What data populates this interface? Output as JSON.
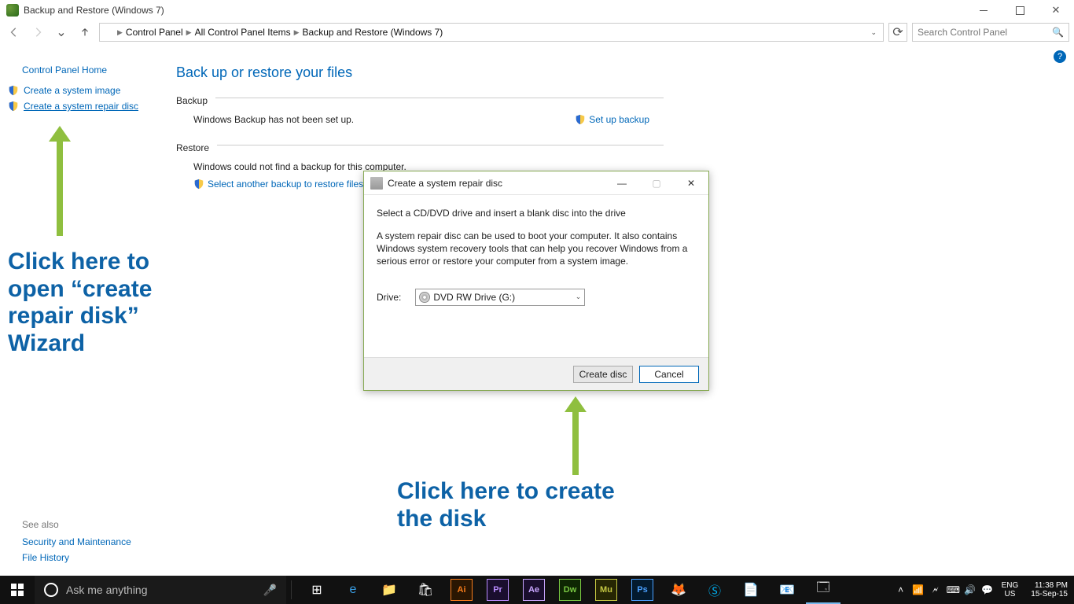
{
  "window": {
    "title": "Backup and Restore (Windows 7)"
  },
  "breadcrumb": {
    "a": "Control Panel",
    "b": "All Control Panel Items",
    "c": "Backup and Restore (Windows 7)"
  },
  "search": {
    "placeholder": "Search Control Panel"
  },
  "sidebar": {
    "home": "Control Panel Home",
    "link1": "Create a system image",
    "link2": "Create a system repair disc"
  },
  "seealso": {
    "hdr": "See also",
    "a": "Security and Maintenance",
    "b": "File History"
  },
  "main": {
    "heading": "Back up or restore your files",
    "backup_label": "Backup",
    "backup_msg": "Windows Backup has not been set up.",
    "setup_link": "Set up backup",
    "restore_label": "Restore",
    "restore_msg": "Windows could not find a backup for this computer.",
    "restore_link": "Select another backup to restore files from"
  },
  "dialog": {
    "title": "Create a system repair disc",
    "line1": "Select a CD/DVD drive and insert a blank disc into the drive",
    "line2": "A system repair disc can be used to boot your computer. It also contains Windows system recovery tools that can help you recover Windows from a serious error or restore your computer from a system image.",
    "drive_label": "Drive:",
    "drive_value": "DVD RW Drive (G:)",
    "create": "Create disc",
    "cancel": "Cancel"
  },
  "annotation": {
    "a1": "Click here to open “create repair disk” Wizard",
    "a2": "Click here to create the disk"
  },
  "taskbar": {
    "cortana": "Ask me anything",
    "lang": "ENG",
    "locale": "US",
    "time": "11:38 PM",
    "date": "15-Sep-15"
  }
}
